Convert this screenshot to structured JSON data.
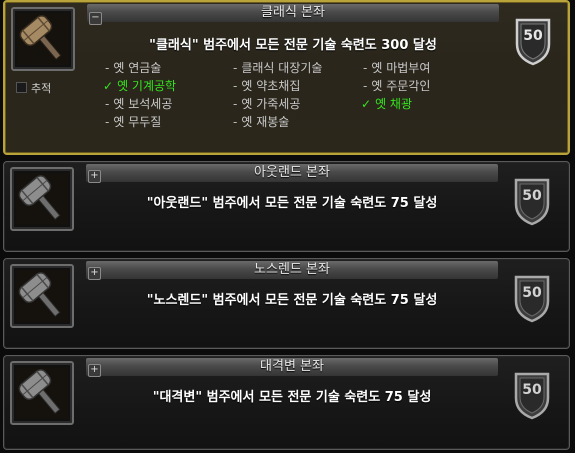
{
  "achievements": [
    {
      "title": "클래식 본좌",
      "description": "\"클래식\" 범주에서 모든 전문 기술 숙련도 300 달성",
      "points": "50",
      "toggle": "−",
      "track_label": "추적",
      "criteria": [
        {
          "label": "옛 연금술",
          "done": false
        },
        {
          "label": "클래식 대장기술",
          "done": false
        },
        {
          "label": "옛 마법부여",
          "done": false
        },
        {
          "label": "옛 기계공학",
          "done": true
        },
        {
          "label": "옛 약초채집",
          "done": false
        },
        {
          "label": "옛 주문각인",
          "done": false
        },
        {
          "label": "옛 보석세공",
          "done": false
        },
        {
          "label": "옛 가죽세공",
          "done": false
        },
        {
          "label": "옛 채광",
          "done": true
        },
        {
          "label": "옛 무두질",
          "done": false
        },
        {
          "label": "옛 재봉술",
          "done": false
        }
      ]
    },
    {
      "title": "아웃랜드 본좌",
      "description": "\"아웃랜드\" 범주에서 모든 전문 기술 숙련도 75 달성",
      "points": "50",
      "toggle": "+"
    },
    {
      "title": "노스렌드 본좌",
      "description": "\"노스렌드\" 범주에서 모든 전문 기술 숙련도 75 달성",
      "points": "50",
      "toggle": "+"
    },
    {
      "title": "대격변 본좌",
      "description": "\"대격변\" 범주에서 모든 전문 기술 숙련도 75 달성",
      "points": "50",
      "toggle": "+"
    }
  ],
  "icons": {
    "achievement": "hammer-icon",
    "points": "shield-icon",
    "completed": "checkmark-icon"
  },
  "colors": {
    "expanded_border": "#b8a43a",
    "completed_text": "#35e51e"
  }
}
